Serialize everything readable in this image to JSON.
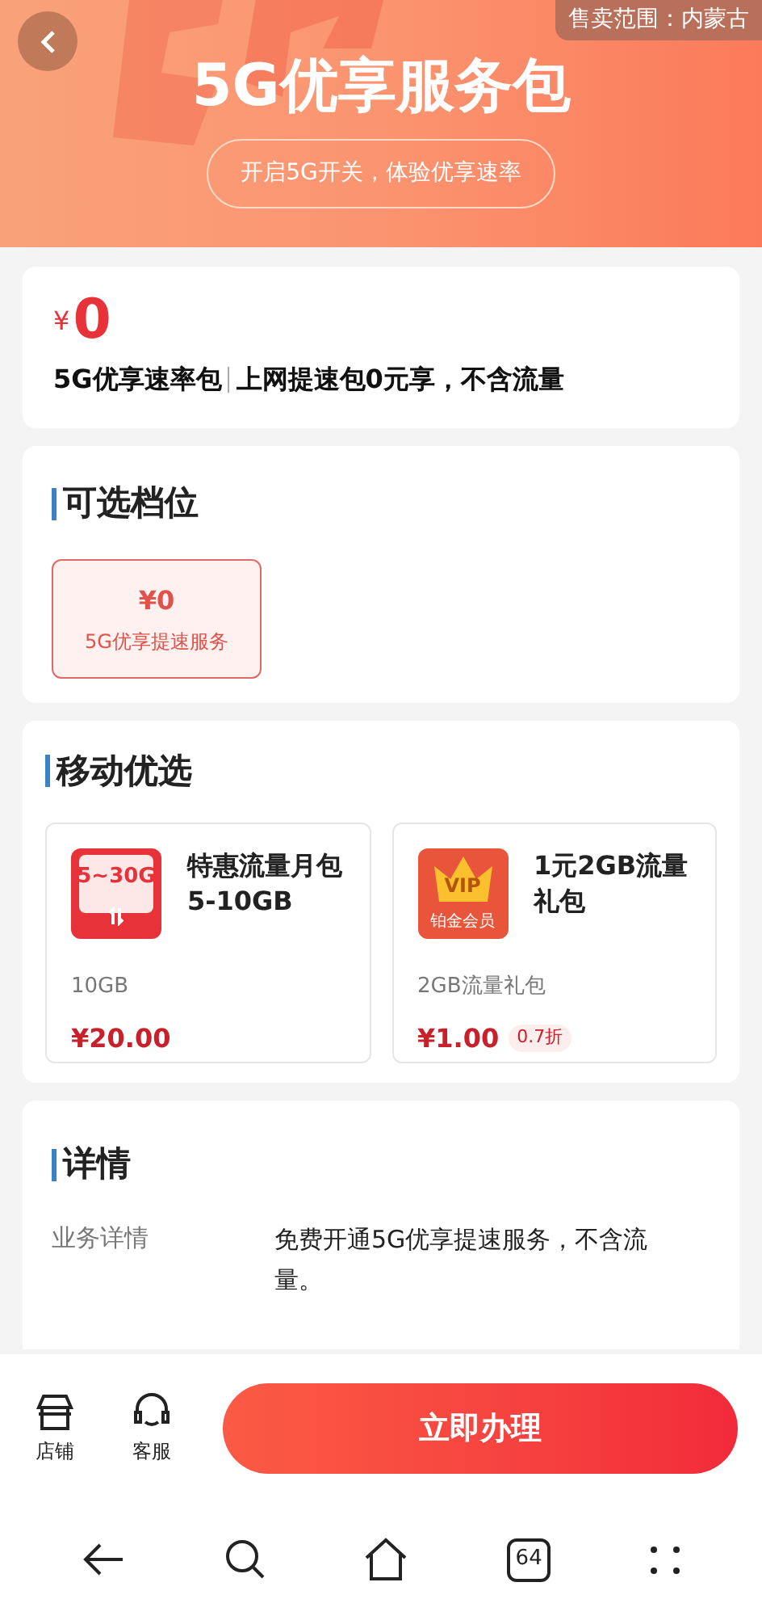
{
  "header": {
    "sales_area": "售卖范围：内蒙古",
    "title": "5G优享服务包",
    "subtitle": "开启5G开关，体验优享速率"
  },
  "price_card": {
    "currency": "¥",
    "price": "0",
    "name": "5G优享速率包",
    "description": "上网提速包0元享，不含流量"
  },
  "tiers": {
    "title": "可选档位",
    "options": [
      {
        "price": "¥0",
        "label": "5G优享提速服务",
        "selected": true
      }
    ]
  },
  "picks": {
    "title": "移动优选",
    "items": [
      {
        "kind": "data",
        "icon_text": [
          "5~30G"
        ],
        "title": "特惠流量月包5-10GB",
        "spec": "10GB",
        "price": "¥20.00"
      },
      {
        "kind": "vip",
        "icon_text": [
          "VIP",
          "铂金会员"
        ],
        "title": "1元2GB流量礼包",
        "spec": "2GB流量礼包",
        "price": "¥1.00",
        "discount": "0.7折"
      }
    ]
  },
  "details": {
    "title": "详情",
    "rows": [
      {
        "label": "业务详情",
        "value": "免费开通5G优享提速服务，不含流量。"
      }
    ]
  },
  "action_bar": {
    "shortcuts": [
      {
        "kind": "store",
        "label": "店铺"
      },
      {
        "kind": "service",
        "label": "客服"
      }
    ],
    "button": "立即办理"
  },
  "nav_bar": {
    "tab_count": "64"
  }
}
